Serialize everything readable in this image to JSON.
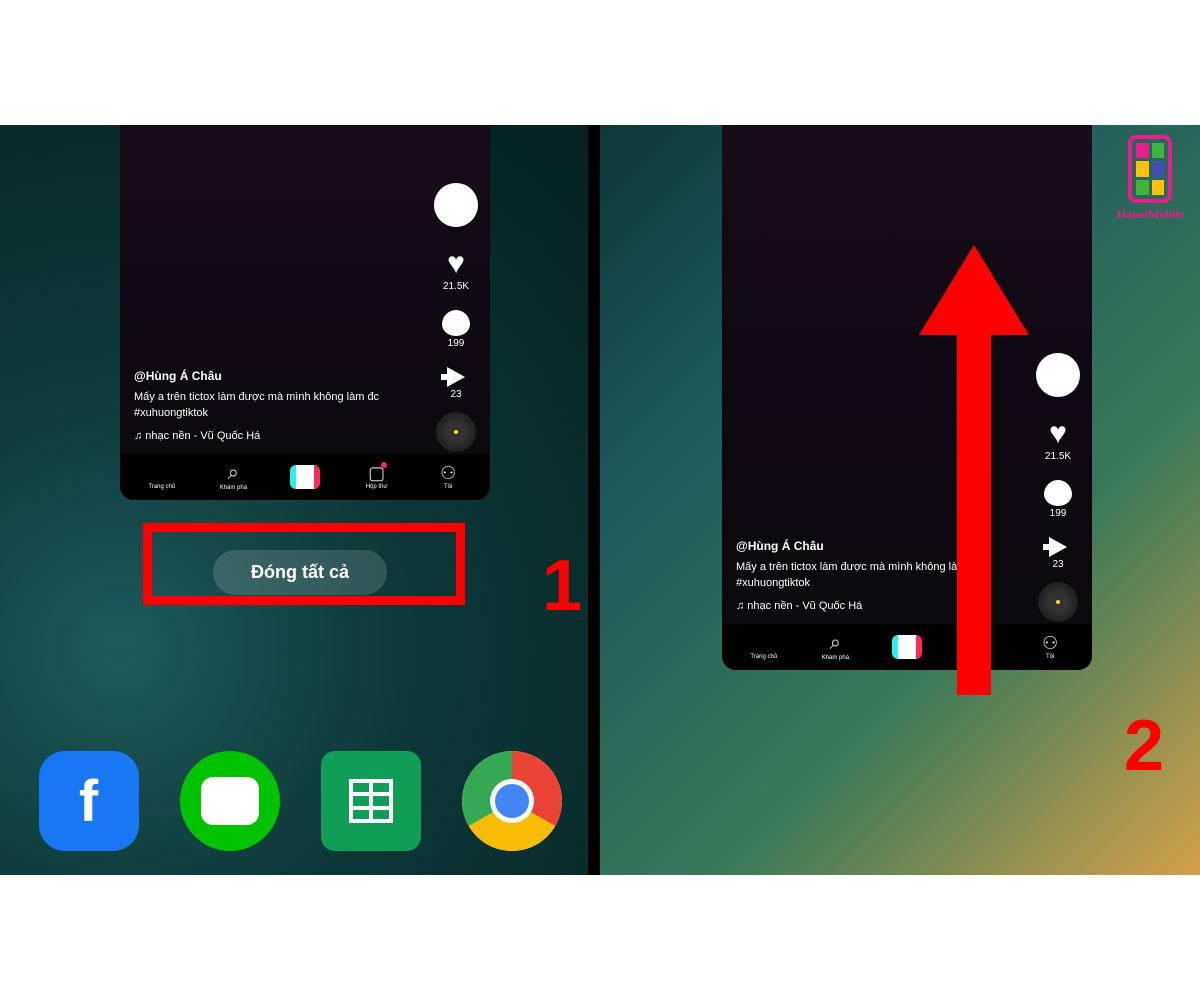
{
  "watermark": {
    "text": "HanoiMobile"
  },
  "steps": {
    "one": "1",
    "two": "2"
  },
  "closeAll": {
    "label": "Đóng tất cả"
  },
  "video": {
    "handle": "@Hùng Á Châu",
    "caption": "Mấy a trên tictox làm được mà mình không làm đc #xuhuongtiktok",
    "music": "♫ nhạc nền - Vũ Quốc Há"
  },
  "counts": {
    "likes": "21.5K",
    "comments": "199",
    "shares": "23"
  },
  "tabs": {
    "home": "Trang chủ",
    "discover": "Khám phá",
    "inbox": "Hộp thư",
    "me": "Tôi"
  },
  "dock": {
    "fb": "f"
  }
}
